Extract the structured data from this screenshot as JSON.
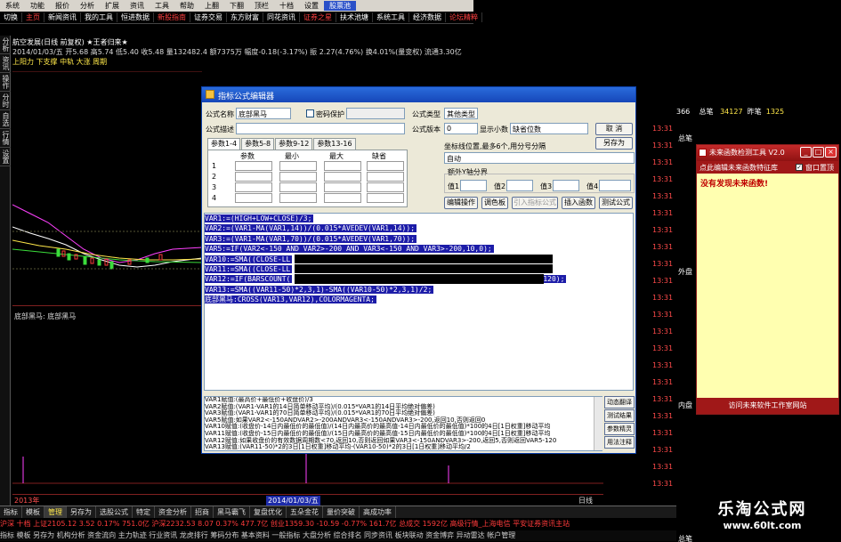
{
  "menu": {
    "items": [
      "系统",
      "功能",
      "报价",
      "分析",
      "扩展",
      "资讯",
      "工具",
      "帮助",
      "上翻",
      "下翻",
      "顶栏",
      "十档",
      "设置",
      "股票池"
    ],
    "selected": "股票池"
  },
  "toolbar2": {
    "items": [
      "切换",
      "主页",
      "新闻资讯",
      "我的工具",
      "恒进数据",
      "新股指南",
      "证券交易",
      "东方财富",
      "同花资讯",
      "证券之星",
      "扶术池塘",
      "系统工具",
      "经济数据",
      "论坛精粹"
    ]
  },
  "left_tabs": [
    "分析",
    "资讯",
    "操作",
    "分时",
    "自选",
    "行情",
    "设置"
  ],
  "stock": {
    "title_line": "航空发展(日线 前复权) ★王者归来★",
    "price_line": "2014/01/03/五 开5.68 高5.74 低5.40 收5.48 量132482.4 额7375万 幅度-0.18(-3.17%) 振 2.27(4.76%) 换4.01%(量变权) 流通3.30亿",
    "row3": "上阳力  下支撑  中轨  大涨  周期",
    "sub_title": "底部黑马: 底部黑马"
  },
  "dialog": {
    "title": "指标公式编辑器",
    "formula_name_label": "公式名称",
    "formula_name_value": "底部黑马",
    "password_label": "密码保护",
    "formula_desc_label": "公式描述",
    "type_label": "公式类型",
    "type_value": "其他类型",
    "version_label": "公式版本",
    "version_value": "0",
    "display_label": "显示小数",
    "display_value": "缺省位数",
    "cancel_btn": "取 消",
    "save_as_btn": "另存为",
    "axis_label": "坐标线位置,最多6个,用分号分隔",
    "axis_value": "自动",
    "extra_y_label": "额外Y轴分界",
    "val_labels": [
      "值1",
      "值2",
      "值3",
      "值4"
    ],
    "param_tabs": [
      "参数1-4",
      "参数5-8",
      "参数9-12",
      "参数13-16"
    ],
    "param_heads": [
      "参数",
      "最小",
      "最大",
      "缺省"
    ],
    "param_rows": [
      "1",
      "2",
      "3",
      "4"
    ],
    "buttons": [
      "编辑操作",
      "调色板",
      "引入指标公式",
      "插入函数",
      "测试公式"
    ],
    "code_lines": [
      "VAR1:=(HIGH+LOW+CLOSE)/3;",
      "VAR2:=(VAR1-MA(VAR1,14))/(0.015*AVEDEV(VAR1,14));",
      "VAR3:=(VAR1-MA(VAR1,70))/(0.015*AVEDEV(VAR1,70));",
      "VAR5:=IF(VAR2<-150 AND VAR2>-200 AND VAR3<-150 AND VAR3>-200,10,0);",
      "VAR10:=SMA((CLOSE-LL",
      "VAR11:=SMA((CLOSE-LL",
      "VAR12:=IF(BARSCOUNT(",
      "VAR13:=SMA((VAR11-50)*2,3,1)-SMA((VAR10-50)*2,3,1)/2;",
      "底部黑马:CROSS(VAR13,VAR12),COLORMAGENTA;"
    ],
    "code_tail_12": "120);",
    "notes": [
      "VAR1赋值:(最高价+最低价+收盘价)/3",
      "VAR2赋值:(VAR1-VAR1的14日简单移动平均)/(0.015*VAR1的14日平均绝对偏差)",
      "VAR3赋值:(VAR1-VAR1的70日简单移动平均)/(0.015*VAR1的70日平均绝对偏差)",
      "VAR5赋值:如果VAR2<-150ANDVAR2>-200ANDVAR3<-150ANDVAR3>-200,返回10,否则返回0",
      "VAR10赋值:(收盘价-14日内最低价的最低值)/(14日内最高价的最高值-14日内最低价的最低值)*100的4日[1日权重]移动平均",
      "VAR11赋值:(收盘价-15日内最低价的最低值)/(15日内最高价的最高值-15日内最低价的最低值)*100的4日[1日权重]移动平均",
      "VAR12赋值:如果收盘价的有效数据周期数<70,返回10,否则返回如果VAR3<-150ANDVAR3>-200,返回5,否则返回VAR5-120",
      "VAR13赋值:(VAR11-50)*2的3日[1日权重]移动平均-(VAR10-50)*2的3日[1日权重]移动平均/2"
    ],
    "side_buttons": [
      "动态翻译",
      "测试结果",
      "参数精灵",
      "用法注释"
    ]
  },
  "ff_tool": {
    "title": "未来函数检测工具 V2.0",
    "bar_text": "点此编辑未来函数特征库",
    "checkbox_label": "窗口置顶",
    "message": "没有发现未来函数!",
    "footer": "访问未来软件工作室网站"
  },
  "right_panel": {
    "times": [
      "13:31",
      "13:31",
      "13:31",
      "13:31",
      "13:31",
      "13:31",
      "13:31",
      "13:31",
      "13:31",
      "13:31",
      "13:31",
      "13:31",
      "13:31",
      "13:31",
      "13:31",
      "13:31",
      "13:31",
      "13:31",
      "13:31",
      "13:31",
      "13:31",
      "13:31"
    ],
    "header": [
      "366",
      "总笔",
      "34127",
      "昨笔",
      "1325"
    ],
    "labels": [
      "总笔",
      "外盘",
      "内盘",
      "总笔"
    ]
  },
  "chart_bottom": {
    "left_date": "2013年",
    "cursor_date": "2014/01/03/五",
    "right_label": "日线"
  },
  "bottom_tabs": {
    "items": [
      "指标",
      "模板",
      "管理",
      "另存为",
      "选股公式",
      "特定",
      "资金分析",
      "招商",
      "黑马霸飞",
      "复盘优化",
      "五朵金花",
      "量价突破",
      "高成功率"
    ],
    "active": "管理"
  },
  "ticker": {
    "line1": "沪深 十档  上证2105.12  3.52  0.17%  751.0亿  沪深2232.53  8.07  0.37%  477.7亿  创业1359.30  -10.59  -0.77%  161.7亿  总成交  1592亿  高级行情_上海电信  平安证券资讯主站",
    "line2": "指标 模板 另存为 机构分析 资金流向 主力轨迹 行业资讯 龙虎排行 筹码分布 基本资料 一般指标 大盘分析 综合排名 同步资讯 板块联动 资金博弈 异动雷达 帐户管理"
  },
  "watermark": {
    "line1": "乐淘公式网",
    "line2": "www.60lt.com"
  }
}
